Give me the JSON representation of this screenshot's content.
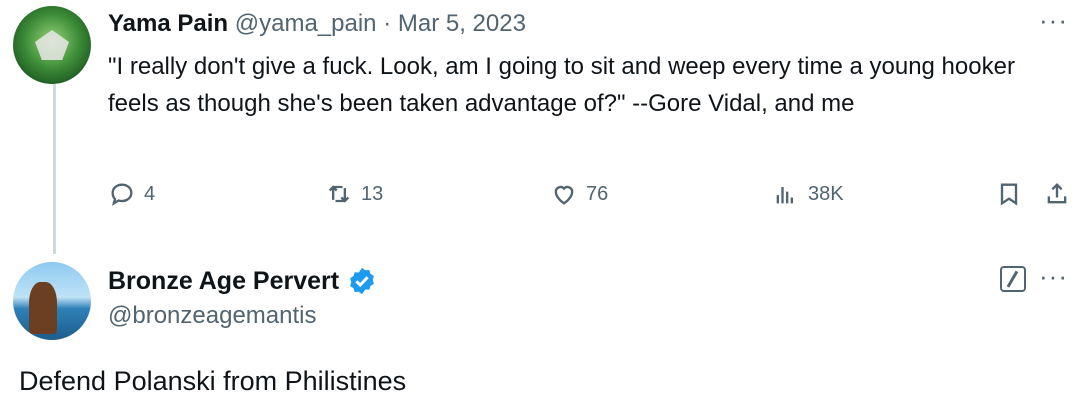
{
  "tweet1": {
    "name": "Yama Pain",
    "handle_date": "@yama_pain · Mar 5, 2023",
    "text": "\"I really don't give a fuck. Look, am I going to sit and weep every time a young hooker feels as though she's been taken advantage of?\" --Gore Vidal, and me",
    "more": "···",
    "actions": {
      "replies": "4",
      "retweets": "13",
      "likes": "76",
      "views": "38K"
    }
  },
  "tweet2": {
    "name": "Bronze Age Pervert",
    "handle": "@bronzeagemantis",
    "more": "···",
    "text": "Defend Polanski from Philistines"
  },
  "colors": {
    "text": "#0f1419",
    "muted": "#536471",
    "verified": "#1d9bf0",
    "thread": "#cfd9de"
  }
}
